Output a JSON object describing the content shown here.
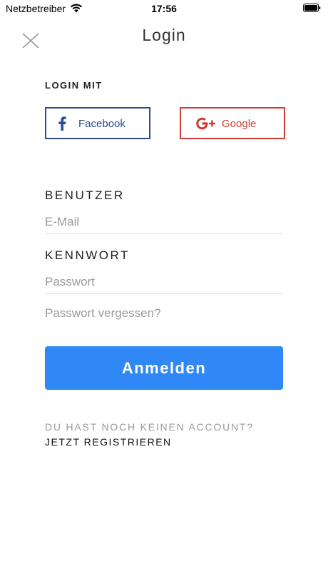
{
  "status_bar": {
    "carrier": "Netzbetreiber",
    "time": "17:56",
    "wifi_icon": "wifi-icon",
    "battery_icon": "battery-icon"
  },
  "header": {
    "title": "Login",
    "close_icon": "close-icon"
  },
  "social": {
    "section_label": "LOGIN MIT",
    "facebook": {
      "label": "Facebook",
      "icon": "facebook-icon",
      "color": "#2d4b8e"
    },
    "google": {
      "label": "Google",
      "icon": "google-plus-icon",
      "color": "#d23c34"
    }
  },
  "form": {
    "user_label": "BENUTZER",
    "user_placeholder": "E-Mail",
    "user_value": "",
    "password_label": "KENNWORT",
    "password_placeholder": "Passwort",
    "password_value": "",
    "forgot_label": "Passwort vergessen?",
    "submit_label": "Anmelden",
    "submit_color": "#2f88f5"
  },
  "footer": {
    "no_account_text": "DU HAST NOCH KEINEN ACCOUNT?",
    "register_label": "JETZT REGISTRIEREN"
  }
}
